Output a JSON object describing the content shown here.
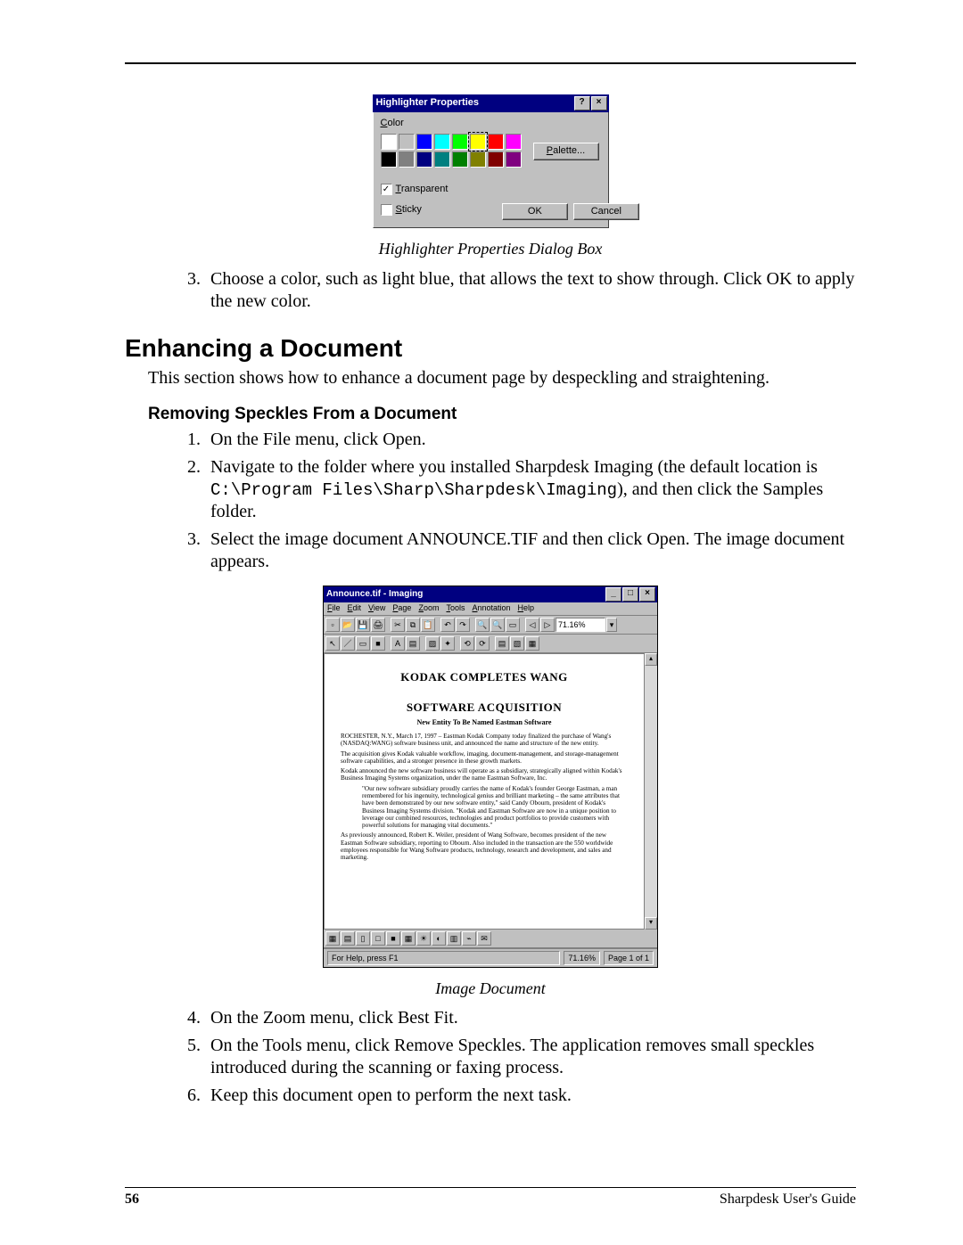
{
  "dialog": {
    "title": "Highlighter Properties",
    "color_label_prefix": "C",
    "color_label_rest": "olor",
    "palette_btn_prefix": "P",
    "palette_btn_rest": "alette...",
    "transparent_prefix": "T",
    "transparent_rest": "ransparent",
    "sticky_prefix": "S",
    "sticky_rest": "ticky",
    "ok": "OK",
    "cancel": "Cancel",
    "help_btn": "?",
    "close_btn": "×",
    "colors_row1": [
      "#ffffff",
      "#c0c0c0",
      "#0000ff",
      "#00ffff",
      "#00ff00",
      "#ffff00",
      "#ff0000",
      "#ff00ff"
    ],
    "colors_row2": [
      "#000000",
      "#808080",
      "#000080",
      "#008080",
      "#008000",
      "#808000",
      "#800000",
      "#800080"
    ],
    "selected_index": 5
  },
  "caption1": "Highlighter Properties Dialog Box",
  "step3": "Choose a color, such as light blue, that allows the text to show through. Click OK to apply the new color.",
  "h2": "Enhancing a Document",
  "intro": "This section shows how to enhance a document page by despeckling and straightening.",
  "h3": "Removing Speckles From a Document",
  "rs1": "On the File menu, click Open.",
  "rs2a": "Navigate to the folder where you installed Sharpdesk Imaging (the default location is ",
  "rs2b": "C:\\Program Files\\Sharp\\Sharpdesk\\Imaging",
  "rs2c": "), and then click the Samples folder.",
  "rs3": "Select the image document ANNOUNCE.TIF and then click Open. The image document appears.",
  "imaging": {
    "title": "Announce.tif - Imaging",
    "min": "_",
    "max": "□",
    "close": "×",
    "menus": [
      "File",
      "Edit",
      "View",
      "Page",
      "Zoom",
      "Tools",
      "Annotation",
      "Help"
    ],
    "zoom_value": "71.16%",
    "headline1": "KODAK COMPLETES WANG",
    "headline2": "SOFTWARE ACQUISITION",
    "subhead": "New Entity To Be Named Eastman Software",
    "p1": "ROCHESTER, N.Y., March 17, 1997 – Eastman Kodak Company today finalized the purchase of Wang's (NASDAQ:WANG) software business unit, and announced the name and structure of the new entity.",
    "p2": "The acquisition gives Kodak valuable workflow, imaging, document-management, and storage-management software capabilities, and a stronger presence in these growth markets.",
    "p3": "Kodak announced the new software business will operate as a subsidiary, strategically aligned within Kodak's Business Imaging Systems organization, under the name Eastman Software, Inc.",
    "p4": "\"Our new software subsidiary proudly carries the name of Kodak's founder George Eastman, a man remembered for his ingenuity, technological genius and brilliant marketing – the same attributes that have been demonstrated by our new software entity,\" said Candy Obourn, president of Kodak's Business Imaging Systems division. \"Kodak and Eastman Software are now in a unique position to leverage our combined resources, technologies and product portfolios to provide customers with powerful solutions for managing vital documents.\"",
    "p5": "As previously announced, Robert K. Weiler, president of Wang Software, becomes president of the new Eastman Software subsidiary, reporting to Obourn. Also included in the transaction are the 550 worldwide employees responsible for Wang Software products, technology, research and development, and sales and marketing.",
    "status_left": "For Help, press F1",
    "status_mid": "71.16%",
    "status_right": "Page 1 of 1"
  },
  "caption2": "Image Document",
  "rs4": "On the Zoom menu, click Best Fit.",
  "rs5": "On the Tools menu, click Remove Speckles. The application removes small speckles introduced during the scanning or faxing process.",
  "rs6": "Keep this document open to perform the next task.",
  "footer": {
    "page": "56",
    "guide": "Sharpdesk User's Guide"
  }
}
